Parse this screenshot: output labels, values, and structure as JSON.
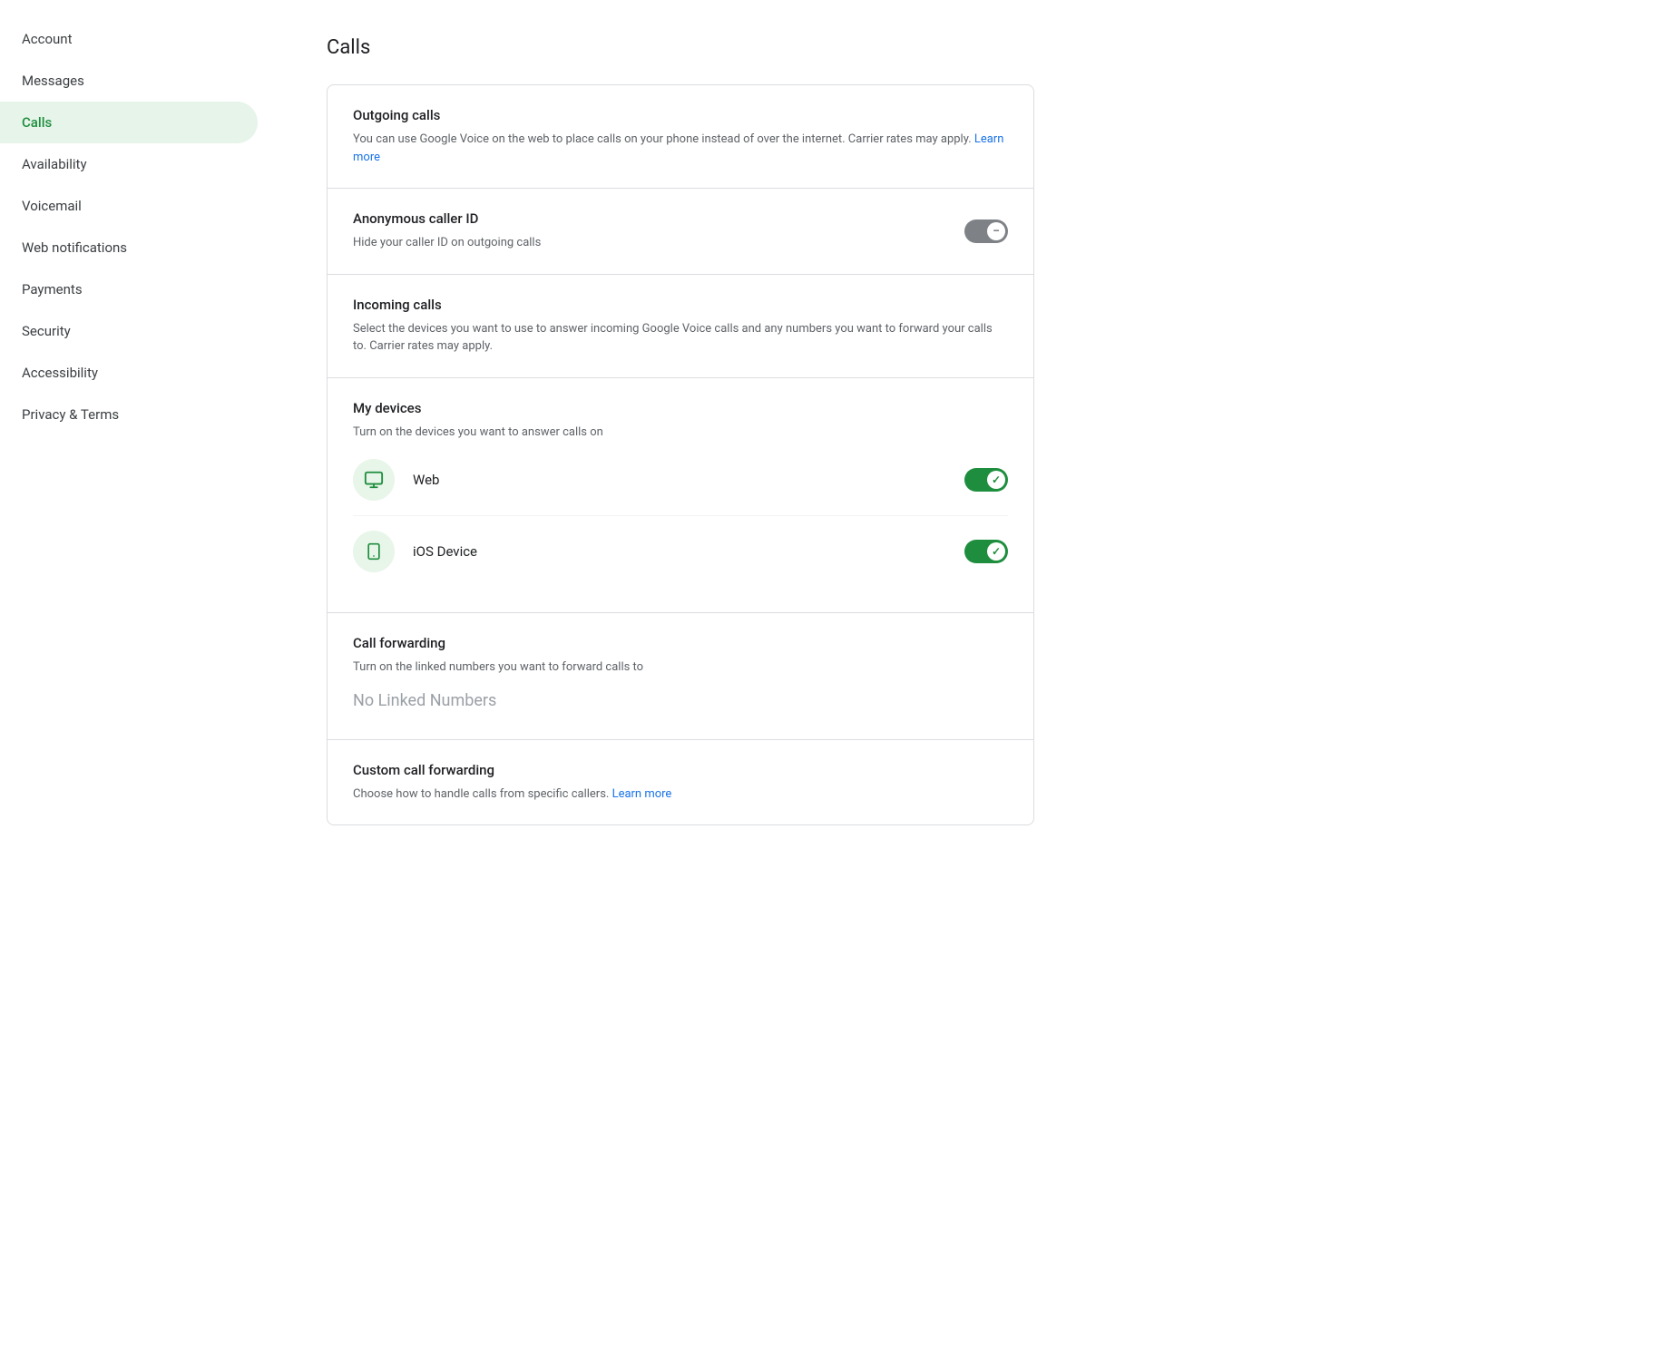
{
  "sidebar": {
    "items": [
      {
        "id": "account",
        "label": "Account",
        "active": false
      },
      {
        "id": "messages",
        "label": "Messages",
        "active": false
      },
      {
        "id": "calls",
        "label": "Calls",
        "active": true
      },
      {
        "id": "availability",
        "label": "Availability",
        "active": false
      },
      {
        "id": "voicemail",
        "label": "Voicemail",
        "active": false
      },
      {
        "id": "web-notifications",
        "label": "Web notifications",
        "active": false
      },
      {
        "id": "payments",
        "label": "Payments",
        "active": false
      },
      {
        "id": "security",
        "label": "Security",
        "active": false
      },
      {
        "id": "accessibility",
        "label": "Accessibility",
        "active": false
      },
      {
        "id": "privacy-terms",
        "label": "Privacy & Terms",
        "active": false
      }
    ]
  },
  "main": {
    "page_title": "Calls",
    "sections": [
      {
        "id": "outgoing-calls",
        "title": "Outgoing calls",
        "desc_before_link": "You can use Google Voice on the web to place calls on your phone instead of over the internet. Carrier rates may apply.",
        "link_text": "Learn more",
        "link_href": "#",
        "has_toggle": false
      },
      {
        "id": "anonymous-caller-id",
        "title": "Anonymous caller ID",
        "desc": "Hide your caller ID on outgoing calls",
        "has_toggle": true,
        "toggle_state": "disabled-off"
      },
      {
        "id": "incoming-calls",
        "title": "Incoming calls",
        "desc": "Select the devices you want to use to answer incoming Google Voice calls and any numbers you want to forward your calls to. Carrier rates may apply.",
        "has_toggle": false
      },
      {
        "id": "my-devices",
        "title": "My devices",
        "desc": "Turn on the devices you want to answer calls on",
        "has_devices": true,
        "devices": [
          {
            "id": "web",
            "label": "Web",
            "icon_type": "monitor",
            "toggle_state": "on"
          },
          {
            "id": "ios-device",
            "label": "iOS Device",
            "icon_type": "mobile",
            "toggle_state": "on"
          }
        ]
      },
      {
        "id": "call-forwarding",
        "title": "Call forwarding",
        "desc": "Turn on the linked numbers you want to forward calls to",
        "no_linked_text": "No Linked Numbers"
      },
      {
        "id": "custom-call-forwarding",
        "title": "Custom call forwarding",
        "desc_before_link": "Choose how to handle calls from specific callers.",
        "link_text": "Learn more",
        "link_href": "#",
        "has_toggle": false
      }
    ]
  },
  "colors": {
    "active_bg": "#e6f4ea",
    "active_text": "#1e8e3e",
    "toggle_on": "#1e8e3e",
    "toggle_off": "#9aa0a6",
    "toggle_disabled": "#5f6368",
    "link_blue": "#1a73e8",
    "device_icon_bg": "#e8f5e9"
  }
}
